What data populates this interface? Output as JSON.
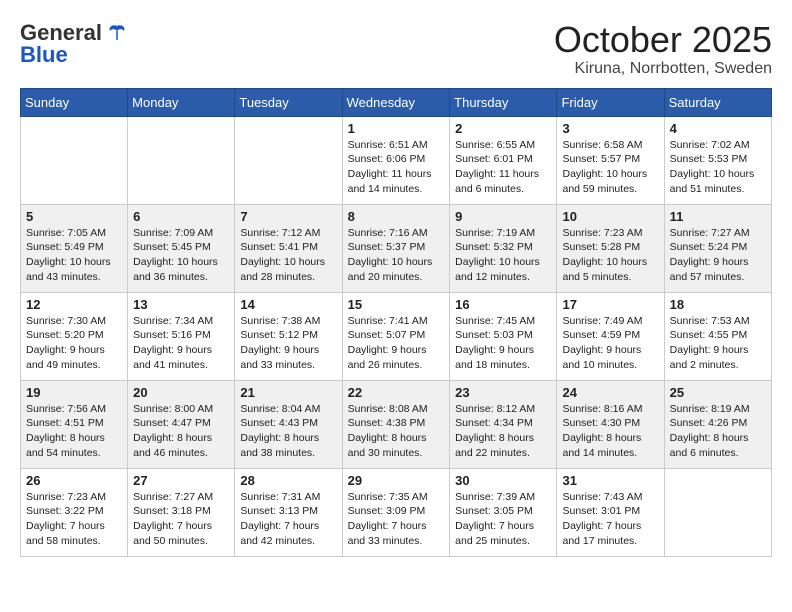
{
  "header": {
    "logo": {
      "general": "General",
      "blue": "Blue"
    },
    "month": "October 2025",
    "location": "Kiruna, Norrbotten, Sweden"
  },
  "days_of_week": [
    "Sunday",
    "Monday",
    "Tuesday",
    "Wednesday",
    "Thursday",
    "Friday",
    "Saturday"
  ],
  "weeks": [
    {
      "shaded": false,
      "days": [
        {
          "number": "",
          "info": ""
        },
        {
          "number": "",
          "info": ""
        },
        {
          "number": "",
          "info": ""
        },
        {
          "number": "1",
          "info": "Sunrise: 6:51 AM\nSunset: 6:06 PM\nDaylight: 11 hours\nand 14 minutes."
        },
        {
          "number": "2",
          "info": "Sunrise: 6:55 AM\nSunset: 6:01 PM\nDaylight: 11 hours\nand 6 minutes."
        },
        {
          "number": "3",
          "info": "Sunrise: 6:58 AM\nSunset: 5:57 PM\nDaylight: 10 hours\nand 59 minutes."
        },
        {
          "number": "4",
          "info": "Sunrise: 7:02 AM\nSunset: 5:53 PM\nDaylight: 10 hours\nand 51 minutes."
        }
      ]
    },
    {
      "shaded": true,
      "days": [
        {
          "number": "5",
          "info": "Sunrise: 7:05 AM\nSunset: 5:49 PM\nDaylight: 10 hours\nand 43 minutes."
        },
        {
          "number": "6",
          "info": "Sunrise: 7:09 AM\nSunset: 5:45 PM\nDaylight: 10 hours\nand 36 minutes."
        },
        {
          "number": "7",
          "info": "Sunrise: 7:12 AM\nSunset: 5:41 PM\nDaylight: 10 hours\nand 28 minutes."
        },
        {
          "number": "8",
          "info": "Sunrise: 7:16 AM\nSunset: 5:37 PM\nDaylight: 10 hours\nand 20 minutes."
        },
        {
          "number": "9",
          "info": "Sunrise: 7:19 AM\nSunset: 5:32 PM\nDaylight: 10 hours\nand 12 minutes."
        },
        {
          "number": "10",
          "info": "Sunrise: 7:23 AM\nSunset: 5:28 PM\nDaylight: 10 hours\nand 5 minutes."
        },
        {
          "number": "11",
          "info": "Sunrise: 7:27 AM\nSunset: 5:24 PM\nDaylight: 9 hours\nand 57 minutes."
        }
      ]
    },
    {
      "shaded": false,
      "days": [
        {
          "number": "12",
          "info": "Sunrise: 7:30 AM\nSunset: 5:20 PM\nDaylight: 9 hours\nand 49 minutes."
        },
        {
          "number": "13",
          "info": "Sunrise: 7:34 AM\nSunset: 5:16 PM\nDaylight: 9 hours\nand 41 minutes."
        },
        {
          "number": "14",
          "info": "Sunrise: 7:38 AM\nSunset: 5:12 PM\nDaylight: 9 hours\nand 33 minutes."
        },
        {
          "number": "15",
          "info": "Sunrise: 7:41 AM\nSunset: 5:07 PM\nDaylight: 9 hours\nand 26 minutes."
        },
        {
          "number": "16",
          "info": "Sunrise: 7:45 AM\nSunset: 5:03 PM\nDaylight: 9 hours\nand 18 minutes."
        },
        {
          "number": "17",
          "info": "Sunrise: 7:49 AM\nSunset: 4:59 PM\nDaylight: 9 hours\nand 10 minutes."
        },
        {
          "number": "18",
          "info": "Sunrise: 7:53 AM\nSunset: 4:55 PM\nDaylight: 9 hours\nand 2 minutes."
        }
      ]
    },
    {
      "shaded": true,
      "days": [
        {
          "number": "19",
          "info": "Sunrise: 7:56 AM\nSunset: 4:51 PM\nDaylight: 8 hours\nand 54 minutes."
        },
        {
          "number": "20",
          "info": "Sunrise: 8:00 AM\nSunset: 4:47 PM\nDaylight: 8 hours\nand 46 minutes."
        },
        {
          "number": "21",
          "info": "Sunrise: 8:04 AM\nSunset: 4:43 PM\nDaylight: 8 hours\nand 38 minutes."
        },
        {
          "number": "22",
          "info": "Sunrise: 8:08 AM\nSunset: 4:38 PM\nDaylight: 8 hours\nand 30 minutes."
        },
        {
          "number": "23",
          "info": "Sunrise: 8:12 AM\nSunset: 4:34 PM\nDaylight: 8 hours\nand 22 minutes."
        },
        {
          "number": "24",
          "info": "Sunrise: 8:16 AM\nSunset: 4:30 PM\nDaylight: 8 hours\nand 14 minutes."
        },
        {
          "number": "25",
          "info": "Sunrise: 8:19 AM\nSunset: 4:26 PM\nDaylight: 8 hours\nand 6 minutes."
        }
      ]
    },
    {
      "shaded": false,
      "days": [
        {
          "number": "26",
          "info": "Sunrise: 7:23 AM\nSunset: 3:22 PM\nDaylight: 7 hours\nand 58 minutes."
        },
        {
          "number": "27",
          "info": "Sunrise: 7:27 AM\nSunset: 3:18 PM\nDaylight: 7 hours\nand 50 minutes."
        },
        {
          "number": "28",
          "info": "Sunrise: 7:31 AM\nSunset: 3:13 PM\nDaylight: 7 hours\nand 42 minutes."
        },
        {
          "number": "29",
          "info": "Sunrise: 7:35 AM\nSunset: 3:09 PM\nDaylight: 7 hours\nand 33 minutes."
        },
        {
          "number": "30",
          "info": "Sunrise: 7:39 AM\nSunset: 3:05 PM\nDaylight: 7 hours\nand 25 minutes."
        },
        {
          "number": "31",
          "info": "Sunrise: 7:43 AM\nSunset: 3:01 PM\nDaylight: 7 hours\nand 17 minutes."
        },
        {
          "number": "",
          "info": ""
        }
      ]
    }
  ]
}
